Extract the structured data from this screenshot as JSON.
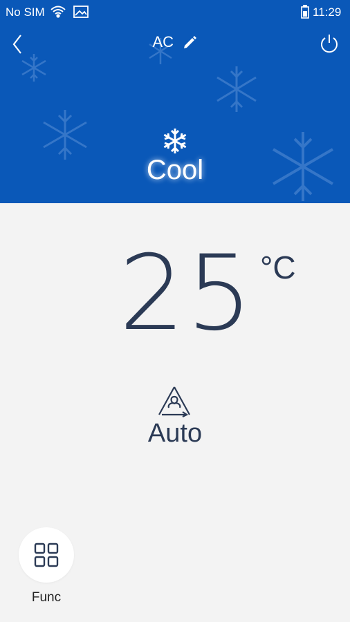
{
  "status_bar": {
    "carrier": "No SIM",
    "time": "11:29"
  },
  "header": {
    "title": "AC"
  },
  "mode": {
    "label": "Cool",
    "icon": "snowflake-icon"
  },
  "temperature": {
    "value": "25",
    "unit": "°C"
  },
  "fan": {
    "label": "Auto",
    "icon": "fan-icon"
  },
  "func": {
    "label": "Func",
    "icon": "grid-icon"
  },
  "colors": {
    "header_bg": "#0a58b8",
    "body_bg": "#f3f3f3",
    "text_dark": "#2b3a55"
  }
}
